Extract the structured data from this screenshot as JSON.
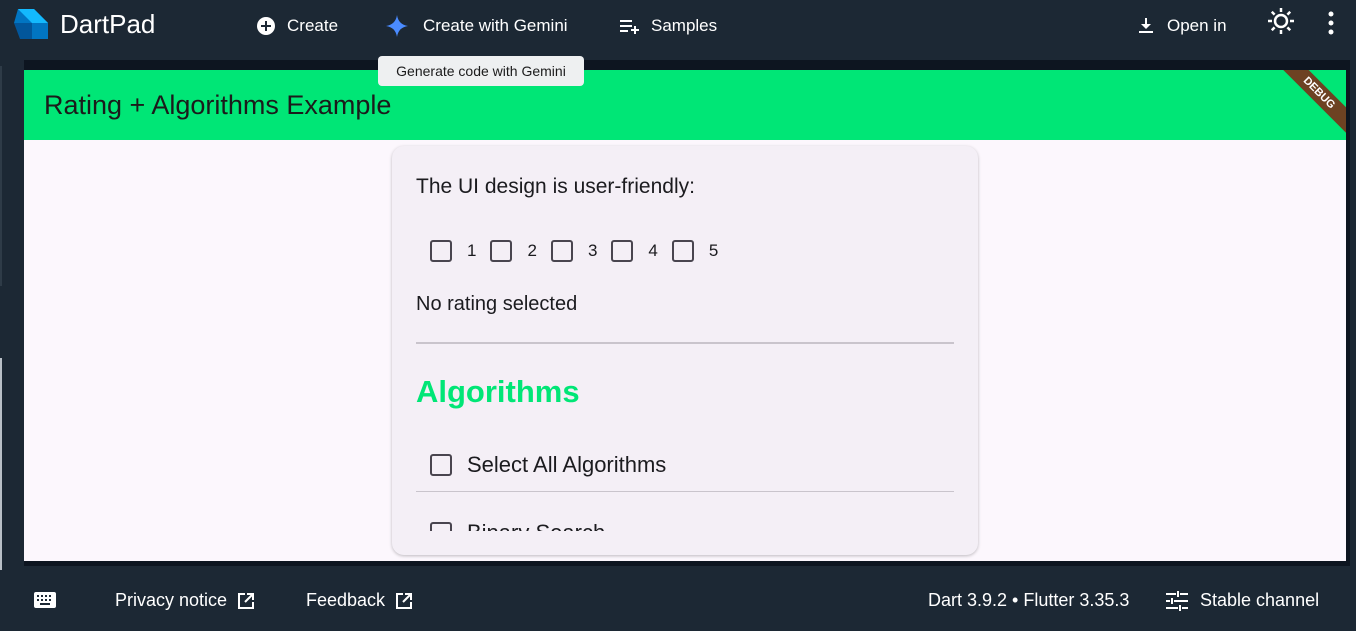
{
  "topbar": {
    "app_title": "DartPad",
    "create_label": "Create",
    "gemini_label": "Create with Gemini",
    "samples_label": "Samples",
    "open_in_label": "Open in",
    "gemini_tooltip": "Generate code with Gemini"
  },
  "app": {
    "appbar_title": "Rating + Algorithms Example",
    "debug_banner": "DEBUG",
    "question": "The UI design is user-friendly:",
    "rating_options": [
      "1",
      "2",
      "3",
      "4",
      "5"
    ],
    "rating_status": "No rating selected",
    "algorithms_heading": "Algorithms",
    "select_all_label": "Select All Algorithms",
    "algorithm_items": [
      "Binary Search"
    ],
    "accent_color": "#00e676"
  },
  "bottombar": {
    "privacy_label": "Privacy notice",
    "feedback_label": "Feedback",
    "version_text": "Dart 3.9.2 • Flutter 3.35.3",
    "channel_label": "Stable channel"
  },
  "icons": [
    "dart-logo",
    "add-circle-icon",
    "gemini-sparkle-icon",
    "playlist-add-icon",
    "download-icon",
    "brightness-icon",
    "more-vert-icon",
    "keyboard-icon",
    "external-link-icon",
    "tune-icon"
  ]
}
